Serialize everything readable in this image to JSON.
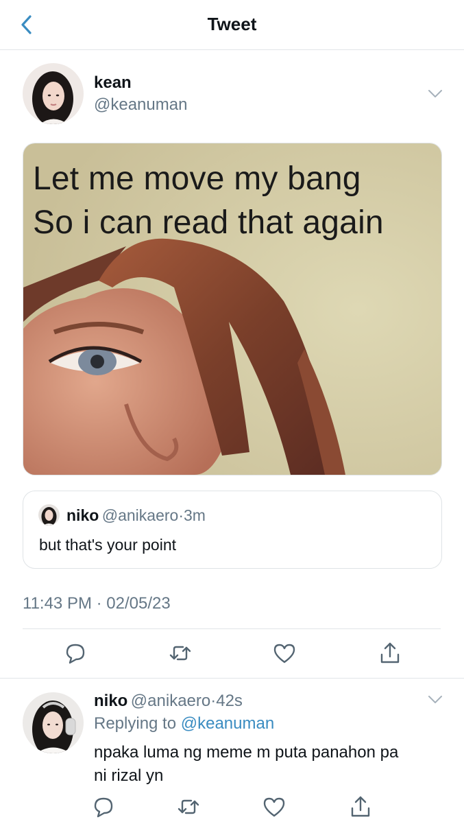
{
  "header": {
    "title": "Tweet",
    "back_icon": "chevron-left-icon",
    "accent": "#3a8cc1"
  },
  "tweet": {
    "author_name": "kean",
    "author_handle": "@keanuman",
    "media": {
      "line1": "Let me move my bang",
      "line2": "So i can read that again"
    },
    "quote": {
      "name": "niko",
      "handle": "@anikaero",
      "separator": "·",
      "time": "3m",
      "text": "but that's your point"
    },
    "timestamp": "11:43 PM · 02/05/23",
    "actions": [
      "reply-icon",
      "retweet-icon",
      "like-icon",
      "share-icon"
    ]
  },
  "reply": {
    "name": "niko",
    "handle": "@anikaero",
    "separator": "·",
    "time": "42s",
    "replying_prefix": "Replying to",
    "replying_to": "@keanuman",
    "text_line1": "npaka luma ng meme m puta panahon pa",
    "text_line2": "ni rizal yn",
    "actions": [
      "reply-icon",
      "retweet-icon",
      "like-icon",
      "share-icon"
    ]
  }
}
